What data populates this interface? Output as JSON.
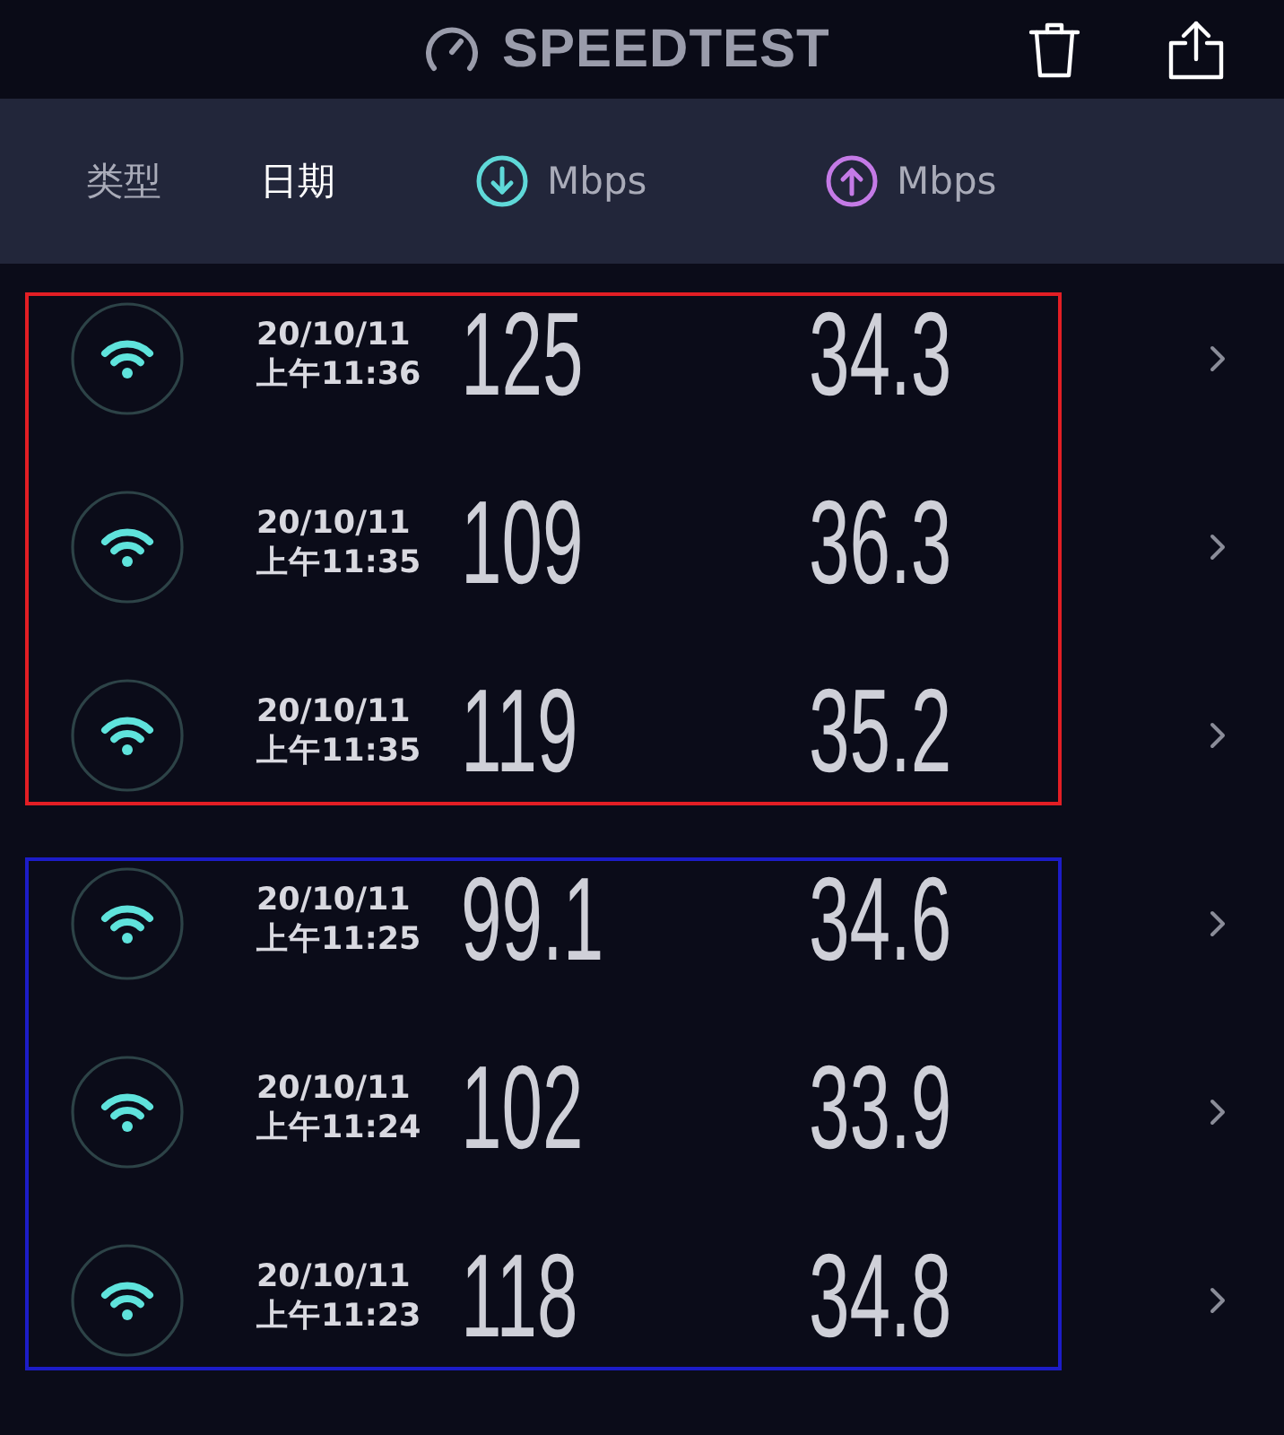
{
  "header": {
    "title": "SPEEDTEST"
  },
  "columns": [
    {
      "label": "类型",
      "kind": "text",
      "selected": false
    },
    {
      "label": "日期",
      "kind": "text",
      "selected": true
    },
    {
      "label": "Mbps",
      "kind": "download",
      "selected": false
    },
    {
      "label": "Mbps",
      "kind": "upload",
      "selected": false
    }
  ],
  "groups": [
    {
      "color": "#e31e24",
      "results": [
        {
          "kind": "wifi",
          "date": "20/10/11",
          "time": "上午11:36",
          "download": "125",
          "upload": "34.3"
        },
        {
          "kind": "wifi",
          "date": "20/10/11",
          "time": "上午11:35",
          "download": "109",
          "upload": "36.3"
        },
        {
          "kind": "wifi",
          "date": "20/10/11",
          "time": "上午11:35",
          "download": "119",
          "upload": "35.2"
        }
      ]
    },
    {
      "color": "#1c1cc8",
      "results": [
        {
          "kind": "wifi",
          "date": "20/10/11",
          "time": "上午11:25",
          "download": "99.1",
          "upload": "34.6"
        },
        {
          "kind": "wifi",
          "date": "20/10/11",
          "time": "上午11:24",
          "download": "102",
          "upload": "33.9"
        },
        {
          "kind": "wifi",
          "date": "20/10/11",
          "time": "上午11:23",
          "download": "118",
          "upload": "34.8"
        }
      ]
    }
  ]
}
